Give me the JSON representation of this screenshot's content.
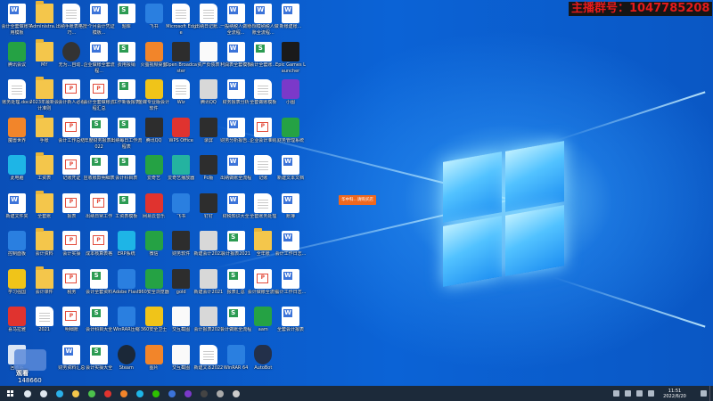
{
  "overlay": {
    "title": "主播群号：1047785208",
    "popup_text": "华中科...请购买店",
    "viewer_label": "观看",
    "viewer_count": "148660"
  },
  "desktop": {
    "icons": [
      {
        "label": "会计全套做账实用模板",
        "type": "word"
      },
      {
        "label": "Administra...",
        "type": "folder"
      },
      {
        "label": "出纳手账表格技巧...",
        "type": "doc"
      },
      {
        "label": "一个月会计凭证模板...",
        "type": "word"
      },
      {
        "label": "题库",
        "type": "xls"
      },
      {
        "label": "飞书",
        "type": "blue"
      },
      {
        "label": "Microsoft Edge",
        "type": "doc"
      },
      {
        "label": "出纳日记账...",
        "type": "doc"
      },
      {
        "label": "一般纳税人做账全流程...",
        "type": "word"
      },
      {
        "label": "小规模纳税人做账全流程...",
        "type": "word"
      },
      {
        "label": "新账建账...",
        "type": "word"
      },
      {
        "label": "腾讯会议",
        "type": "green"
      },
      {
        "label": "MY",
        "type": "folder"
      },
      {
        "label": "无为...自动...",
        "type": "camera"
      },
      {
        "label": "企业做账全套流程...",
        "type": "word"
      },
      {
        "label": "费用报销",
        "type": "xls"
      },
      {
        "label": "火萤视频桌面",
        "type": "orange"
      },
      {
        "label": "Open Broadcaster",
        "type": "dark"
      },
      {
        "label": "资产负债表",
        "type": "white"
      },
      {
        "label": "利润表全套模板",
        "type": "word"
      },
      {
        "label": "会计全套账...",
        "type": "xls"
      },
      {
        "label": "Epic Games Launcher",
        "type": "epic"
      },
      {
        "label": "账务处理.docx",
        "type": "doc"
      },
      {
        "label": "2023年最新会计准则",
        "type": "folder"
      },
      {
        "label": "会计新人必看",
        "type": "pdf"
      },
      {
        "label": "会计全套做账流程汇总",
        "type": "pdf"
      },
      {
        "label": "工作新版报表",
        "type": "xls"
      },
      {
        "label": "金蝶专业版会计软件",
        "type": "yellow"
      },
      {
        "label": "Wiz",
        "type": "doc"
      },
      {
        "label": "腾讯QQ",
        "type": "gray"
      },
      {
        "label": "财务报表分析",
        "type": "word"
      },
      {
        "label": "全套做账模板",
        "type": "doc"
      },
      {
        "label": "小图",
        "type": "purple"
      },
      {
        "label": "魔兽世界",
        "type": "orange"
      },
      {
        "label": "手账",
        "type": "folder"
      },
      {
        "label": "会计工作总结",
        "type": "pdf"
      },
      {
        "label": "年度财务报表2022",
        "type": "xls"
      },
      {
        "label": "出纳每日工作流程表",
        "type": "xls"
      },
      {
        "label": "腾讯QQ",
        "type": "dark"
      },
      {
        "label": "WPS Office",
        "type": "red"
      },
      {
        "label": "录屏",
        "type": "dark"
      },
      {
        "label": "财务分析报告...",
        "type": "word"
      },
      {
        "label": "企业会计准则",
        "type": "pdf"
      },
      {
        "label": "财务管理系统",
        "type": "green"
      },
      {
        "label": "此电脑",
        "type": "cyan"
      },
      {
        "label": "工资表",
        "type": "folder"
      },
      {
        "label": "记账凭证",
        "type": "pdf"
      },
      {
        "label": "应收账款明细表",
        "type": "xls"
      },
      {
        "label": "会计科目表",
        "type": "xls"
      },
      {
        "label": "爱奇艺",
        "type": "green"
      },
      {
        "label": "爱奇艺播放器",
        "type": "teal"
      },
      {
        "label": "Pc版",
        "type": "dark"
      },
      {
        "label": "出纳做账全流程",
        "type": "word"
      },
      {
        "label": "记账",
        "type": "doc"
      },
      {
        "label": "新建文本文档",
        "type": "word"
      },
      {
        "label": "新建文件夹",
        "type": "word"
      },
      {
        "label": "全套账",
        "type": "folder"
      },
      {
        "label": "报表",
        "type": "pdf"
      },
      {
        "label": "出纳日常工作",
        "type": "pdf"
      },
      {
        "label": "工资表模板",
        "type": "xls"
      },
      {
        "label": "网易云音乐",
        "type": "red"
      },
      {
        "label": "飞书",
        "type": "blue"
      },
      {
        "label": "钉钉",
        "type": "dark"
      },
      {
        "label": "财税知识大全",
        "type": "word"
      },
      {
        "label": "全套账务处理",
        "type": "doc"
      },
      {
        "label": "账簿",
        "type": "word"
      },
      {
        "label": "控制面板",
        "type": "blue"
      },
      {
        "label": "会计资料",
        "type": "folder"
      },
      {
        "label": "会计实操",
        "type": "pdf"
      },
      {
        "label": "成本核算表格",
        "type": "pdf"
      },
      {
        "label": "ERP系统",
        "type": "cyan"
      },
      {
        "label": "微信",
        "type": "green"
      },
      {
        "label": "财务软件",
        "type": "dark"
      },
      {
        "label": "新建会计2022",
        "type": "gray"
      },
      {
        "label": "会计报表2021",
        "type": "xls"
      },
      {
        "label": "全年账",
        "type": "folder"
      },
      {
        "label": "会计工作日志...",
        "type": "word"
      },
      {
        "label": "学习强国",
        "type": "yellow"
      },
      {
        "label": "会计课件",
        "type": "folder"
      },
      {
        "label": "税务",
        "type": "pdf"
      },
      {
        "label": "会计全套资料",
        "type": "xls"
      },
      {
        "label": "Adobe Flash",
        "type": "blue"
      },
      {
        "label": "360安全浏览器",
        "type": "green"
      },
      {
        "label": "gold",
        "type": "dark"
      },
      {
        "label": "新建会计2021",
        "type": "gray"
      },
      {
        "label": "报表汇总",
        "type": "xls"
      },
      {
        "label": "会计做账全流程",
        "type": "pdf"
      },
      {
        "label": "会计工作日志...",
        "type": "word"
      },
      {
        "label": "喜马拉雅",
        "type": "red"
      },
      {
        "label": "2021",
        "type": "doc"
      },
      {
        "label": "明细账",
        "type": "pdf"
      },
      {
        "label": "会计科目大全",
        "type": "xls"
      },
      {
        "label": "WinRAR压缩",
        "type": "blue"
      },
      {
        "label": "360安全卫士",
        "type": "yellow"
      },
      {
        "label": "交互截图",
        "type": "white"
      },
      {
        "label": "会计报表2021",
        "type": "gray"
      },
      {
        "label": "会计做账全流程",
        "type": "xls"
      },
      {
        "label": "aam",
        "type": "green"
      },
      {
        "label": "全套会计报表",
        "type": "word"
      },
      {
        "label": "回收站",
        "type": "recycle"
      },
      {
        "label": "",
        "type": "none"
      },
      {
        "label": "财务资料汇总",
        "type": "word"
      },
      {
        "label": "会计实操大全",
        "type": "xls"
      },
      {
        "label": "Steam",
        "type": "steam"
      },
      {
        "label": "图片",
        "type": "orange"
      },
      {
        "label": "交互截图",
        "type": "white"
      },
      {
        "label": "新建文本2022",
        "type": "doc"
      },
      {
        "label": "WinRAR 64",
        "type": "blue"
      },
      {
        "label": "AutoBot",
        "type": "shield"
      },
      {
        "label": "",
        "type": "none"
      }
    ]
  },
  "taskbar": {
    "apps": [
      {
        "name": "search",
        "color": "#dfe7ef"
      },
      {
        "name": "task-view",
        "color": "#dfe7ef"
      },
      {
        "name": "edge",
        "color": "#2bb0e8"
      },
      {
        "name": "file-explorer",
        "color": "#f4c64b"
      },
      {
        "name": "app-green",
        "color": "#4cc24c"
      },
      {
        "name": "wps",
        "color": "#e0332f"
      },
      {
        "name": "app-orange",
        "color": "#f2852a"
      },
      {
        "name": "qq",
        "color": "#1eb5e6"
      },
      {
        "name": "wechat",
        "color": "#2dc100"
      },
      {
        "name": "app-blue",
        "color": "#3b73d9"
      },
      {
        "name": "app-purple",
        "color": "#7b39c9"
      },
      {
        "name": "obs",
        "color": "#444444"
      },
      {
        "name": "app-gray",
        "color": "#aaaaaa"
      },
      {
        "name": "camera",
        "color": "#cccccc"
      }
    ],
    "clock": {
      "time": "11:51",
      "date": "2022/6/20"
    }
  }
}
